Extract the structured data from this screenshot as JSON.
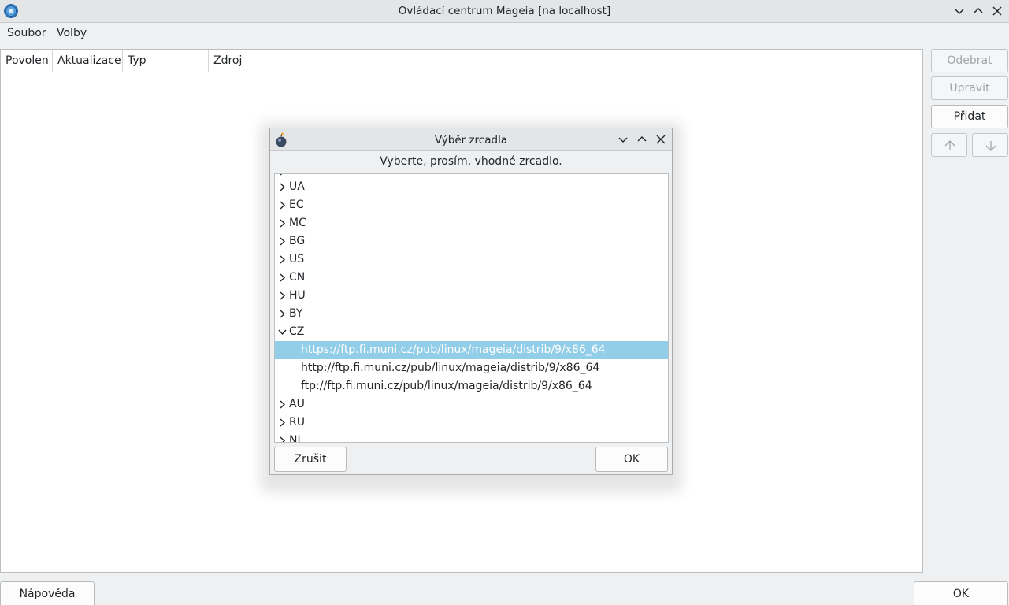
{
  "window": {
    "title": "Ovládací centrum Mageia [na localhost]",
    "menu": [
      "Soubor",
      "Volby"
    ]
  },
  "table": {
    "columns": [
      "Povolen",
      "Aktualizace",
      "Typ",
      "Zdroj"
    ]
  },
  "side_buttons": {
    "remove": "Odebrat",
    "edit": "Upravit",
    "add": "Přidat"
  },
  "bottom": {
    "help": "Nápověda",
    "ok": "OK"
  },
  "dialog": {
    "title": "Výběr zrcadla",
    "prompt": "Vyberte, prosím, vhodné zrcadlo.",
    "countries": [
      "UA",
      "EC",
      "MC",
      "BG",
      "US",
      "CN",
      "HU",
      "BY",
      "CZ"
    ],
    "expanded_country": "CZ",
    "mirrors": [
      "https://ftp.fi.muni.cz/pub/linux/mageia/distrib/9/x86_64",
      "http://ftp.fi.muni.cz/pub/linux/mageia/distrib/9/x86_64",
      "ftp://ftp.fi.muni.cz/pub/linux/mageia/distrib/9/x86_64"
    ],
    "countries_after": [
      "AU",
      "RU",
      "NL"
    ],
    "selected_mirror_index": 0,
    "cancel": "Zrušit",
    "ok": "OK"
  },
  "colors": {
    "selection": "#93cee9",
    "window_bg": "#eff0f1"
  }
}
